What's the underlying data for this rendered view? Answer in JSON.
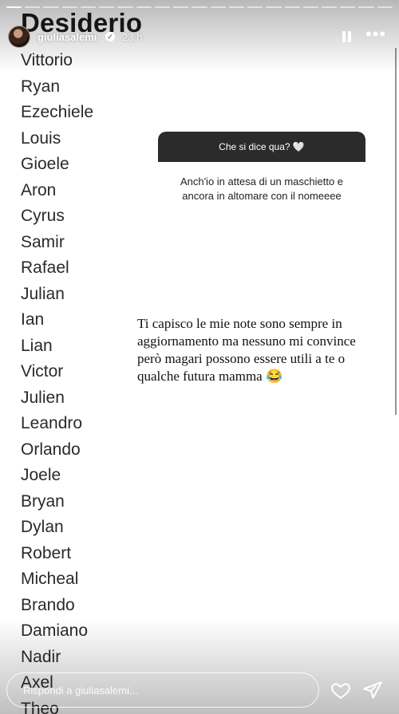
{
  "story": {
    "list_title": "Desiderio",
    "progress": {
      "segments": 21,
      "current": 1
    },
    "names": [
      "Vittorio",
      "Ryan",
      "Ezechiele",
      "Louis",
      "Gioele",
      "Aron",
      "Cyrus",
      "Samir",
      "Rafael",
      "Julian",
      "Ian",
      "Lian",
      "Victor",
      "Julien",
      "Leandro",
      "Orlando",
      "Joele",
      "Bryan",
      "Dylan",
      "Robert",
      "Micheal",
      "Brando",
      "Damiano",
      "Nadir",
      "Axel",
      "Theo"
    ]
  },
  "header": {
    "username": "giuliasalemi",
    "verified_mark": "✓",
    "time": "23 h",
    "more_label": "•••"
  },
  "question": {
    "prompt": "Che si dice qua? 🤍",
    "answer": "Anch'io in attesa di un maschietto e ancora in altomare con il nomeeee"
  },
  "reply_text": "Ti capisco le mie note sono sempre in aggiornamento ma nessuno mi convince però magari possono essere utili a te o qualche futura mamma 😂",
  "footer": {
    "placeholder": "Rispondi a giuliasalemi..."
  },
  "colors": {
    "question_header_bg": "#2b2b2b",
    "text_dark": "#2a2a2a"
  },
  "icons": [
    "pause-icon",
    "more-icon",
    "heart-icon",
    "send-icon",
    "verified-icon"
  ]
}
